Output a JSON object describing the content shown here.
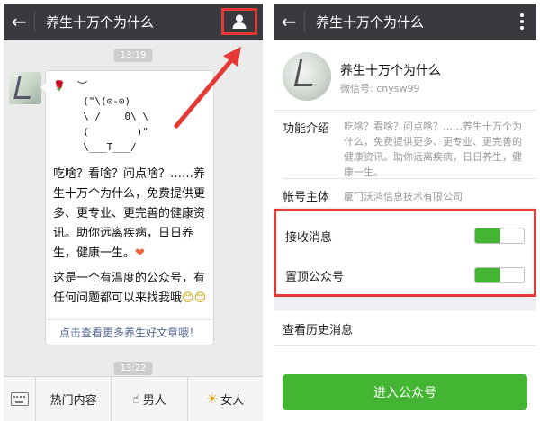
{
  "left": {
    "header": {
      "back_icon": "←",
      "title": "养生十万个为什么",
      "profile_icon": "person-icon"
    },
    "timestamps": [
      "13:19",
      "13:22"
    ],
    "message": {
      "ascii_lines": [
        "🌹  ︶",
        "     (\"\\(⊙-⊙)",
        "     \\ /    0\\ \\",
        "     (        )\"",
        "     \\___T___/"
      ],
      "text1": "吃啥？看啥？问点啥？……养生十万个为什么，免费提供更多、更专业、更完善的健康资讯。助你远离疾病，日日养生，健康一生。",
      "heart": "❤",
      "text2": "这是一个有温度的公众号，有任何问题都可以来找我哦",
      "emoji": "😊😊",
      "link": "点击查看更多养生好文章哦！"
    },
    "menu": [
      {
        "label": "热门内容",
        "icon": ""
      },
      {
        "label": "男人",
        "icon": "☝"
      },
      {
        "label": "女人",
        "icon": "☀"
      }
    ]
  },
  "right": {
    "header": {
      "back_icon": "←",
      "title": "养生十万个为什么",
      "more_icon": "more-vertical-icon"
    },
    "account": {
      "name": "养生十万个为什么",
      "wechat_id": "微信号: cnysw99"
    },
    "intro": {
      "label": "功能介绍",
      "value": "吃啥？看啥？问点啥？……养生十万个为什么，免费提供更多、更专业、更完善的健康资讯。助你远离疾病，日日养生，健康一生。"
    },
    "entity": {
      "label": "帐号主体",
      "value": "厦门沃鸿信息技术有限公司"
    },
    "toggles": [
      {
        "label": "接收消息",
        "on": true
      },
      {
        "label": "置顶公众号",
        "on": true
      }
    ],
    "history": "查看历史消息",
    "enter_button": "进入公众号"
  },
  "colors": {
    "topbar": "#393a3f",
    "accent_green": "#44b533",
    "highlight_red": "#e53935",
    "link_blue": "#576b95"
  }
}
